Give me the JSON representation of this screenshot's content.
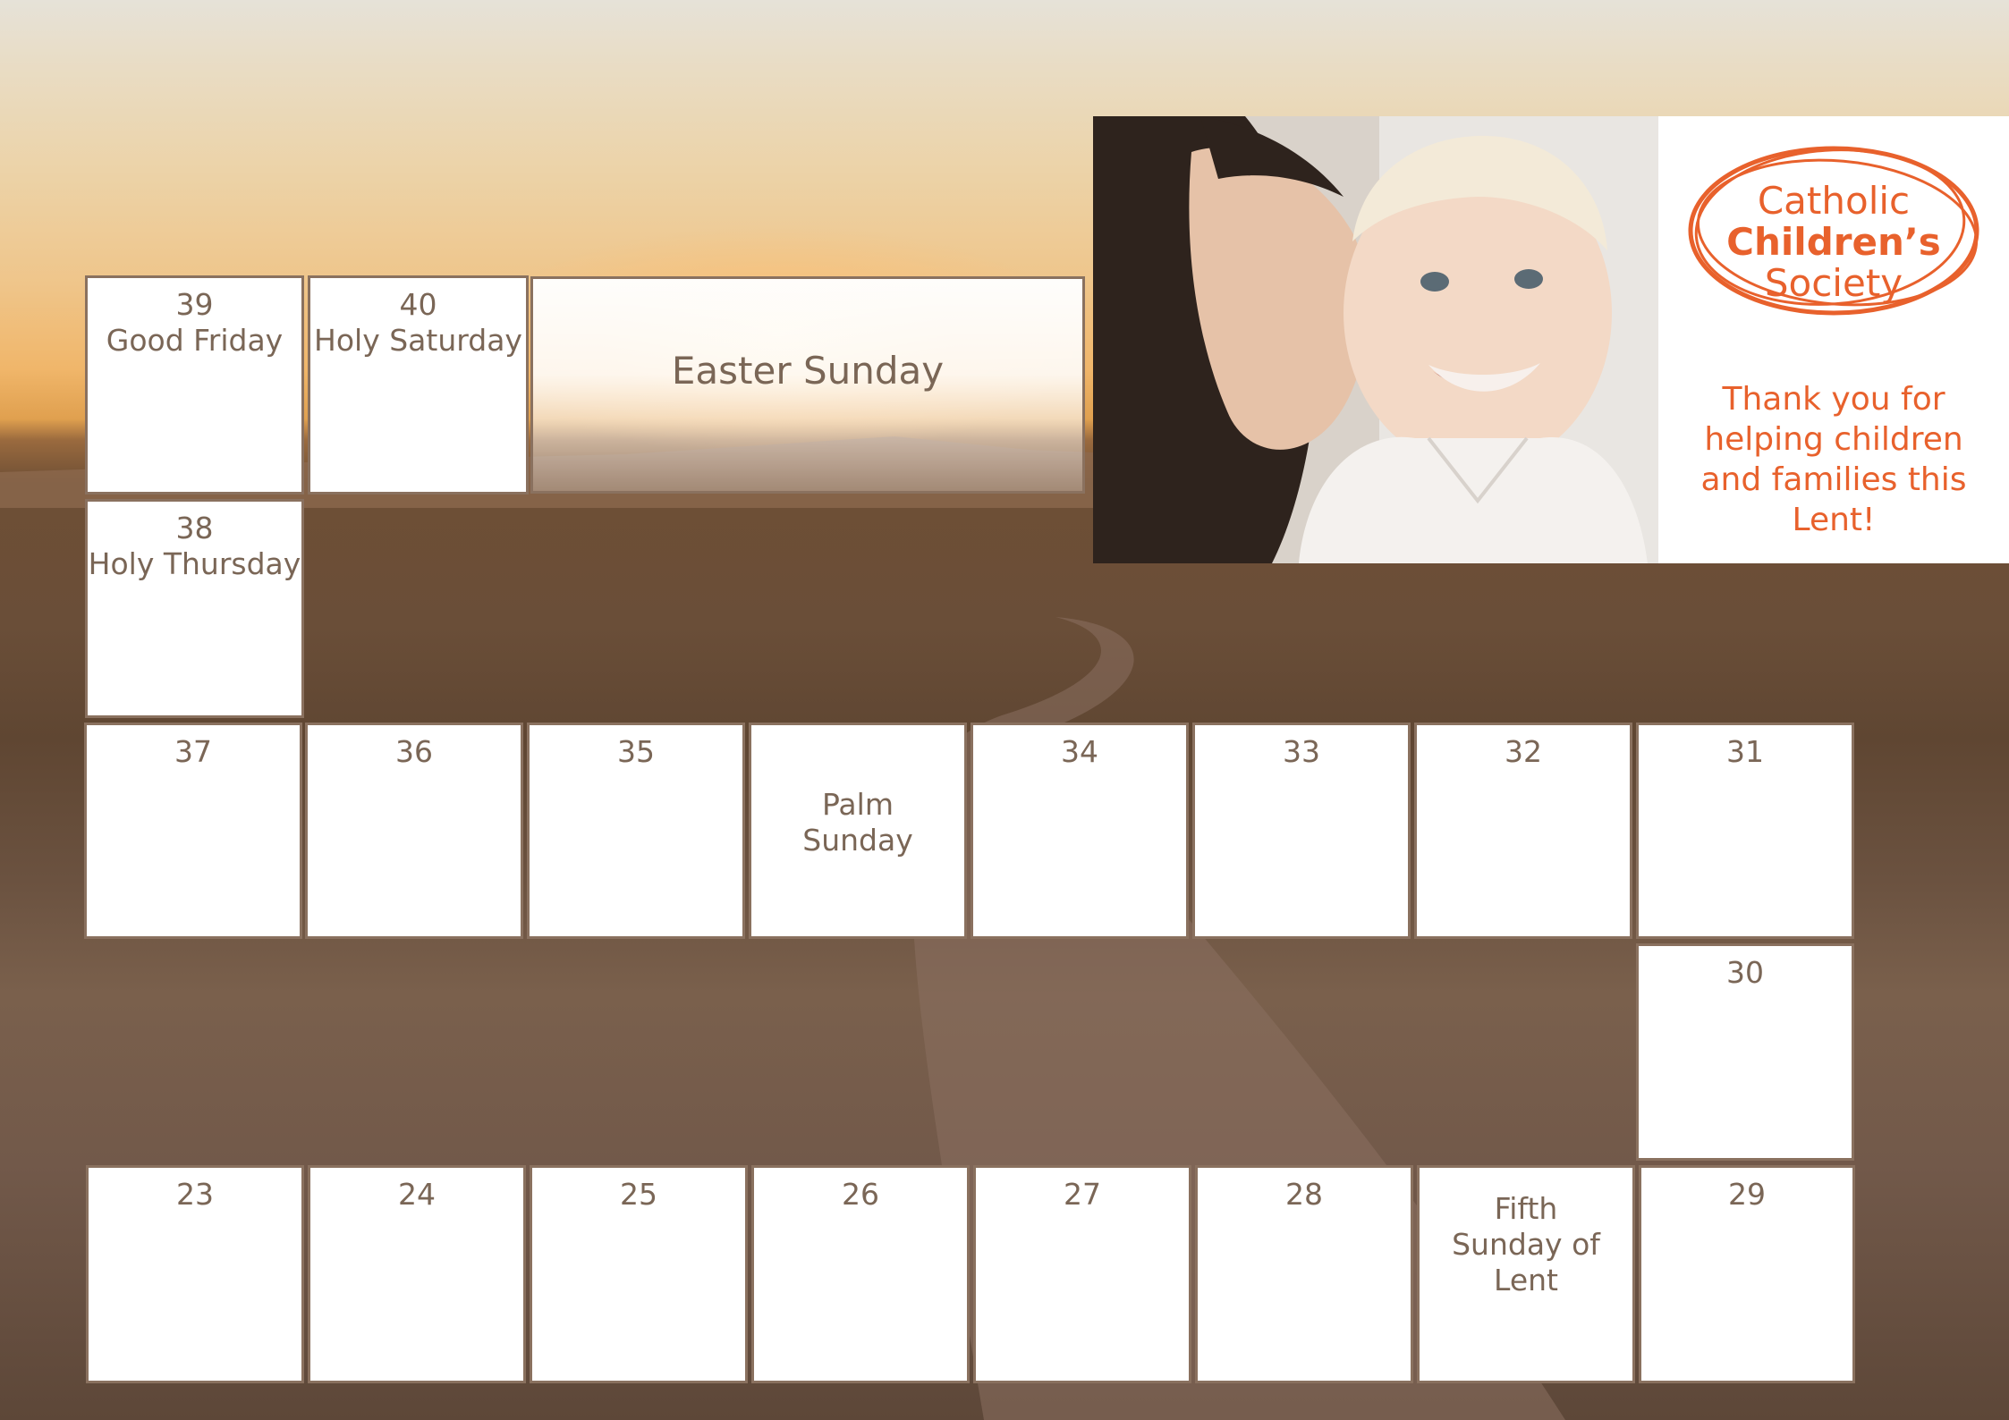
{
  "calendar": {
    "top_row": [
      {
        "num": "39",
        "label": "Good Friday"
      },
      {
        "num": "40",
        "label": "Holy Saturday"
      }
    ],
    "easter": {
      "label": "Easter Sunday"
    },
    "day38": {
      "num": "38",
      "label": "Holy Thursday"
    },
    "row_middle": [
      {
        "num": "37"
      },
      {
        "num": "36"
      },
      {
        "num": "35"
      },
      {
        "label": "Palm Sunday"
      },
      {
        "num": "34"
      },
      {
        "num": "33"
      },
      {
        "num": "32"
      },
      {
        "num": "31"
      }
    ],
    "day30": {
      "num": "30"
    },
    "row_bottom": [
      {
        "num": "23"
      },
      {
        "num": "24"
      },
      {
        "num": "25"
      },
      {
        "num": "26"
      },
      {
        "num": "27"
      },
      {
        "num": "28"
      },
      {
        "label": "Fifth Sunday of Lent"
      },
      {
        "num": "29"
      }
    ]
  },
  "brand": {
    "logo_line1": "Catholic",
    "logo_line2": "Children’s",
    "logo_line3": "Society",
    "thanks_message": "Thank you for helping children and families this Lent!",
    "color": "#e8612c"
  },
  "icons": [
    "photo-mother-baby",
    "logo-scribble-circle"
  ]
}
